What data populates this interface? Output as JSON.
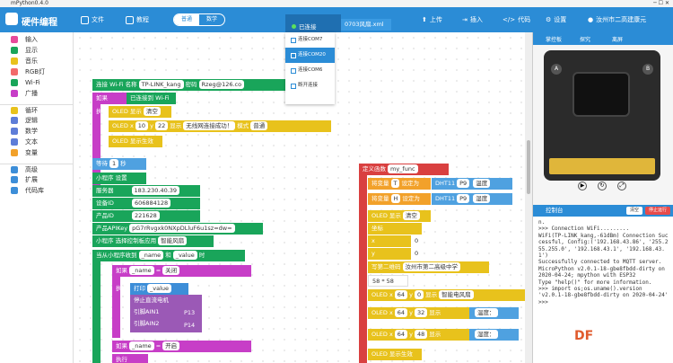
{
  "app": {
    "title": "mPython0.4.0",
    "brand": "硬件编程"
  },
  "toolbar": {
    "file": "文件",
    "tutorial": "教程",
    "mode_normal": "普通",
    "mode_python": "数学",
    "connected": "已连接",
    "filename": "0703风扇.xml",
    "upload": "上传",
    "import": "插入",
    "code": "代码",
    "settings": "设置",
    "user": "汝州市二高建康元"
  },
  "port_menu": [
    {
      "label": "连接COM7",
      "selected": false
    },
    {
      "label": "连接COM20",
      "selected": true
    },
    {
      "label": "连接COM6",
      "selected": false
    },
    {
      "label": "断开连接",
      "selected": false
    }
  ],
  "sidebar": [
    {
      "label": "输入",
      "color": "#e64b9b"
    },
    {
      "label": "显示",
      "color": "#19a55a"
    },
    {
      "label": "音乐",
      "color": "#e8c21c"
    },
    {
      "label": "RGB灯",
      "color": "#f26b6b"
    },
    {
      "label": "Wi-Fi",
      "color": "#19a55a"
    },
    {
      "label": "广播",
      "color": "#c73ec7"
    },
    {
      "label": "循环",
      "color": "#e8c21c"
    },
    {
      "label": "逻辑",
      "color": "#5e7dd8"
    },
    {
      "label": "数学",
      "color": "#5e7dd8"
    },
    {
      "label": "文本",
      "color": "#5e7dd8"
    },
    {
      "label": "变量",
      "color": "#f2a12a"
    },
    {
      "label": "高级",
      "color": "#3d8ed8"
    },
    {
      "label": "扩展",
      "color": "#3d8ed8"
    },
    {
      "label": "代码库",
      "color": "#3d8ed8"
    }
  ],
  "blocks": {
    "wifi_label": "连接 Wi-Fi 名称",
    "wifi_name": "TP-LINK_kang",
    "wifi_pwd_label": "密码",
    "wifi_pwd": "Rzeg@126.co",
    "if": "如果",
    "wifi_ok": "已连接到 Wi-Fi",
    "then": "执行",
    "oled_show": "OLED 显示",
    "clear": "清空",
    "oled": "OLED",
    "x": "x",
    "y": "y",
    "show": "显示",
    "wifi_msg": "无线网连接成功！",
    "mode": "模式",
    "normal": "普通",
    "oled_effect": "OLED 显示生效",
    "wait": "等待",
    "wait_val": "1",
    "sec": "秒",
    "mini_settings": "小程序 设置",
    "server": "服务器",
    "server_val": "183.230.40.39",
    "devid": "设备ID",
    "devid_val": "606884128",
    "prodid": "产品ID",
    "prodid_val": "221628",
    "apikey": "产品APIKey",
    "apikey_val": "pG7rRvgxk0NXpDLluF6u1sz=dw=",
    "mini_select": "小程序 选择控制板应用",
    "mini_app": "智能风扇",
    "on_recv": "当从小程序收到",
    "name": "_name",
    "and": "和",
    "value": "_value",
    "when": "时",
    "eq": "=",
    "off": "关闭",
    "print": "打印",
    "stop_motor": "停止直流电机",
    "pin_ain1": "引脚AIN1",
    "pin_ain2": "引脚AIN2",
    "p13": "P13",
    "p14": "P14",
    "on": "开启",
    "def_func": "定义函数",
    "func_name": "my_func",
    "setvar": "将变量",
    "var_t": "T",
    "var_h": "H",
    "set_to": "设定为",
    "dht": "DHT11",
    "p9": "P9",
    "temp": "温度",
    "hum": "湿度",
    "coord": "坐标",
    "x0": "0",
    "y0": "0",
    "qr": "写第二维码",
    "school": "汝州市第二高级中学",
    "size": "58 * 58",
    "x64": "64",
    "y0b": "0",
    "smart_fan": "智能电风扇",
    "y32": "32",
    "temp_show": "温度：",
    "y48": "48",
    "hum_show": "湿度：",
    "x10": "10",
    "y22": "22"
  },
  "right_panel": {
    "tabs": [
      "掌控板",
      "探究",
      "离屏"
    ],
    "console_title": "控制台",
    "btn_clear": "清空",
    "btn_stop": "停止运行"
  },
  "console_lines": "n.\n>>> Connection WiFi.........\nWiFi(TP-LINK_kang,-61dBm) Connection Successful, Config:('192.168.43.86', '255.255.255.0', '192.168.43.1', '192.168.43.1')\nSuccessfully connected to MQTT server.\nMicroPython v2.0.1-18-gbe8fbdd-dirty on 2020-04-24; mpython with ESP32\nType \"help()\" for more information.\n>>> import os;os.uname().version\n'v2.0.1-18-gbe8fbdd-dirty on 2020-04-24'\n>>>",
  "watermark": "DF"
}
